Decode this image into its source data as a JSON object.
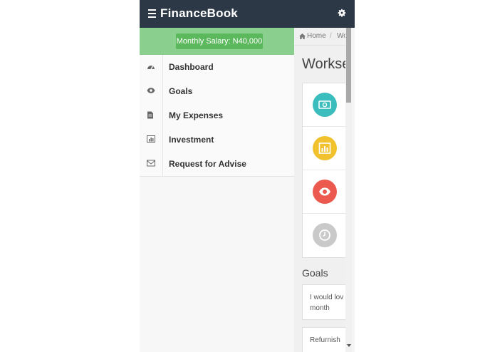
{
  "header": {
    "app_title": "FinanceBook",
    "menu_icon": "hamburger-menu-icon",
    "settings_icon": "gear-icon"
  },
  "sidebar": {
    "salary": "Monthly Salary: N40,000",
    "items": [
      {
        "label": "Dashboard",
        "icon": "dashboard-gauge-icon"
      },
      {
        "label": "Goals",
        "icon": "eye-icon"
      },
      {
        "label": "My Expenses",
        "icon": "document-icon"
      },
      {
        "label": "Investment",
        "icon": "bar-chart-icon"
      },
      {
        "label": "Request for Advise",
        "icon": "envelope-icon"
      }
    ]
  },
  "main": {
    "breadcrumb": {
      "home": "Home",
      "separator": "/",
      "current": "Wo"
    },
    "title": "Workse",
    "tiles": [
      {
        "icon": "money-icon",
        "color": "#3bbdbd"
      },
      {
        "icon": "chart-icon",
        "color": "#f2c12e"
      },
      {
        "icon": "eye-icon",
        "color": "#ec5a4f"
      },
      {
        "icon": "clock-icon",
        "color": "#c9c9c9"
      }
    ],
    "goals_heading": "Goals",
    "goals": [
      {
        "line1": "I would lov",
        "line2": "month"
      },
      {
        "line1": "Refurnish"
      }
    ]
  },
  "colors": {
    "topbar": "#2c3846",
    "salary_bar": "#8bcf8f",
    "salary_badge": "#5cb85c"
  }
}
